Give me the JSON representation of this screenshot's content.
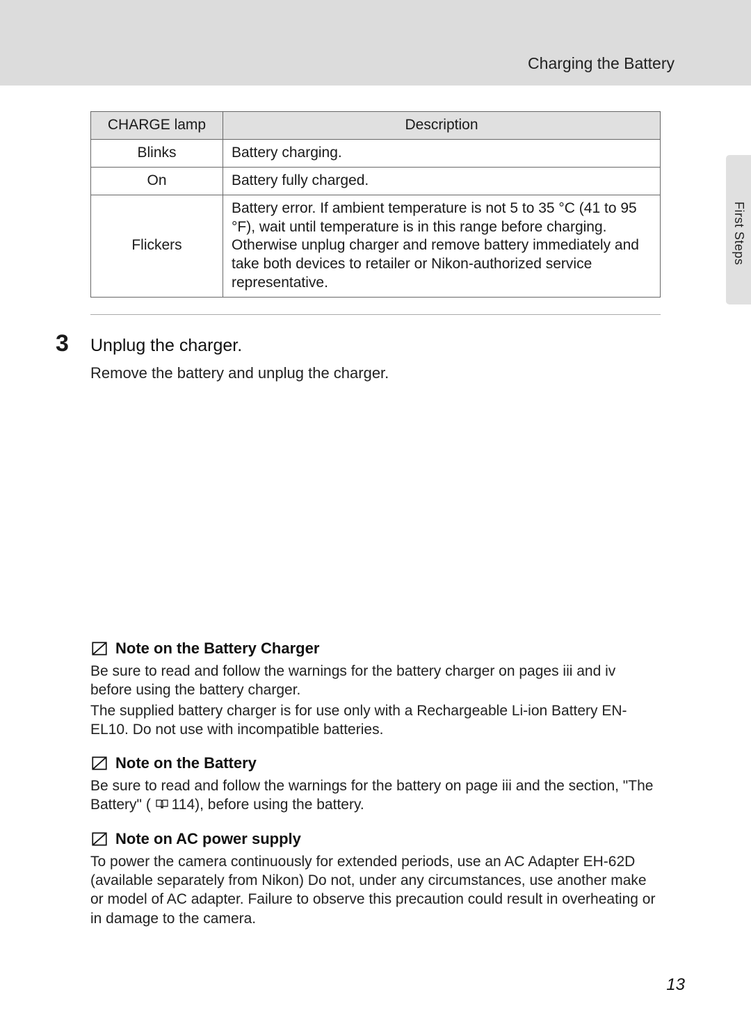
{
  "header": {
    "running_title": "Charging the Battery",
    "side_tab": "First Steps"
  },
  "table": {
    "col1": "CHARGE lamp",
    "col2": "Description",
    "rows": [
      {
        "lamp": "Blinks",
        "desc": "Battery charging."
      },
      {
        "lamp": "On",
        "desc": "Battery fully charged."
      },
      {
        "lamp": "Flickers",
        "desc": "Battery error. If ambient temperature is not 5 to 35 °C (41 to 95 °F), wait until temperature is in this range before charging. Otherwise unplug charger and remove battery immediately and take both devices to retailer or Nikon-authorized service representative."
      }
    ]
  },
  "step": {
    "number": "3",
    "title": "Unplug the charger.",
    "body": "Remove the battery and unplug the charger."
  },
  "notes": {
    "charger": {
      "title": "Note on the Battery Charger",
      "p1": "Be sure to read and follow the warnings for the battery charger on pages iii and iv before using the battery charger.",
      "p2": "The supplied battery charger is for use only with a Rechargeable Li-ion Battery EN-EL10. Do not use with incompatible batteries."
    },
    "battery": {
      "title": "Note on the Battery",
      "p1_a": "Be sure to read and follow the warnings for the battery on page iii and the section, \"The Battery\" (",
      "p1_ref": "114",
      "p1_b": "), before using the battery."
    },
    "ac": {
      "title": "Note on AC power supply",
      "p1": "To power the camera continuously for extended periods, use an AC Adapter EH-62D (available separately from Nikon) Do not, under any circumstances, use another make or model of AC adapter. Failure to observe this precaution could result in overheating or in damage to the camera."
    }
  },
  "page_number": "13"
}
